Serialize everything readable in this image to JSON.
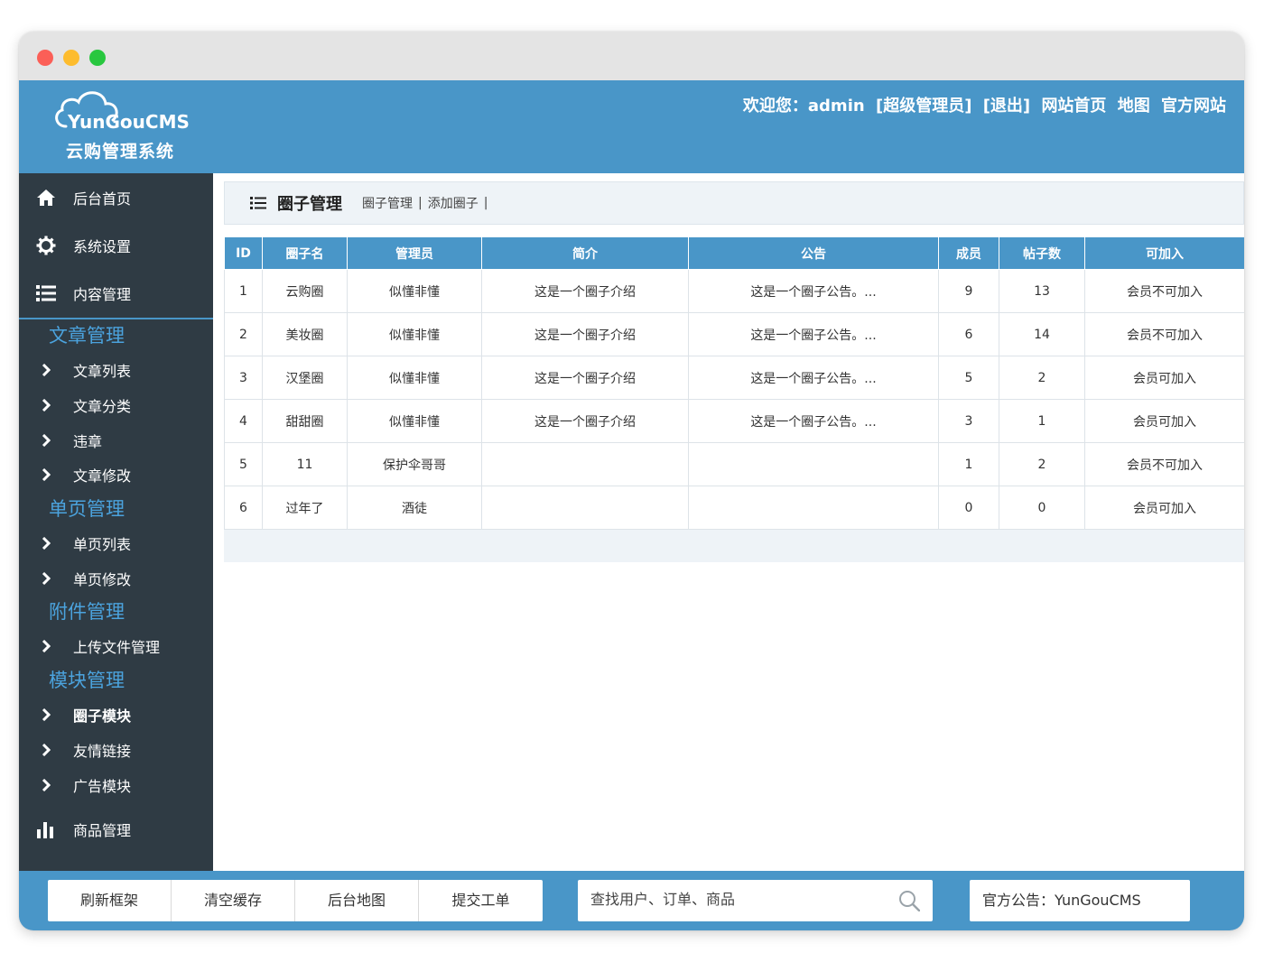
{
  "header": {
    "brand": "YunGouCMS",
    "subtitle": "云购管理系统",
    "welcome": "欢迎您：admin",
    "links": [
      "[超级管理员]",
      "[退出]",
      "网站首页",
      "地图",
      "官方网站"
    ]
  },
  "sidebar": {
    "top_items": [
      {
        "label": "后台首页",
        "icon": "home-icon"
      },
      {
        "label": "系统设置",
        "icon": "gear-icon"
      },
      {
        "label": "内容管理",
        "icon": "list-icon"
      }
    ],
    "groups": [
      {
        "title": "文章管理",
        "items": [
          "文章列表",
          "文章分类",
          "违章",
          "文章修改"
        ]
      },
      {
        "title": "单页管理",
        "items": [
          "单页列表",
          "单页修改"
        ]
      },
      {
        "title": "附件管理",
        "items": [
          "上传文件管理"
        ]
      },
      {
        "title": "模块管理",
        "items": [
          "圈子模块",
          "友情链接",
          "广告模块"
        ]
      }
    ],
    "active_item": "圈子模块",
    "bottom_item": {
      "label": "商品管理",
      "icon": "bar-chart-icon"
    }
  },
  "breadcrumb": {
    "title": "圈子管理",
    "links": [
      "圈子管理",
      "添加圈子"
    ],
    "separator": "|"
  },
  "table": {
    "columns": [
      "ID",
      "圈子名",
      "管理员",
      "简介",
      "公告",
      "成员",
      "帖子数",
      "可加入"
    ],
    "rows": [
      [
        "1",
        "云购圈",
        "似懂非懂",
        "这是一个圈子介绍",
        "这是一个圈子公告。...",
        "9",
        "13",
        "会员不可加入"
      ],
      [
        "2",
        "美妆圈",
        "似懂非懂",
        "这是一个圈子介绍",
        "这是一个圈子公告。...",
        "6",
        "14",
        "会员不可加入"
      ],
      [
        "3",
        "汉堡圈",
        "似懂非懂",
        "这是一个圈子介绍",
        "这是一个圈子公告。...",
        "5",
        "2",
        "会员可加入"
      ],
      [
        "4",
        "甜甜圈",
        "似懂非懂",
        "这是一个圈子介绍",
        "这是一个圈子公告。...",
        "3",
        "1",
        "会员可加入"
      ],
      [
        "5",
        "11",
        "保护伞哥哥",
        "",
        "",
        "1",
        "2",
        "会员不可加入"
      ],
      [
        "6",
        "过年了",
        "酒徒",
        "",
        "",
        "0",
        "0",
        "会员可加入"
      ]
    ]
  },
  "footer": {
    "buttons": [
      "刷新框架",
      "清空缓存",
      "后台地图",
      "提交工单"
    ],
    "search_placeholder": "查找用户、订单、商品",
    "notice": "官方公告：YunGouCMS"
  },
  "colors": {
    "brand_blue": "#4996c8",
    "sidebar_bg": "#2f3b44",
    "sidebar_group": "#4ba3de"
  }
}
